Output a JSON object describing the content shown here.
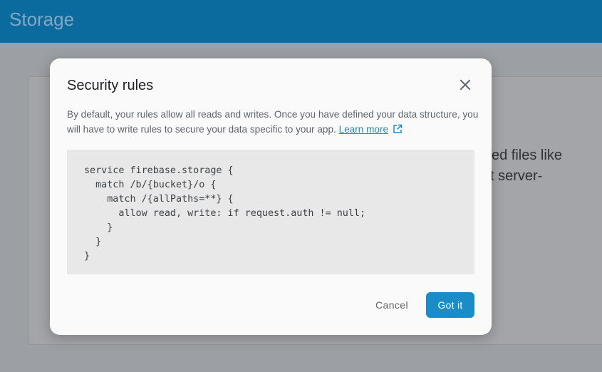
{
  "header": {
    "title": "Storage"
  },
  "background": {
    "partial_text_line1": "ed files like",
    "partial_text_line2": "t server-"
  },
  "dialog": {
    "title": "Security rules",
    "close_icon": "close-icon",
    "description": "By default, your rules allow all reads and writes. Once you have defined your data structure, you will have to write rules to secure your data specific to your app.",
    "learn_more_label": "Learn more",
    "learn_more_icon": "external-link-icon",
    "code_lines": [
      "service firebase.storage {",
      "  match /b/{bucket}/o {",
      "    match /{allPaths=**} {",
      "      allow read, write: if request.auth != null;",
      "    }",
      "  }",
      "}"
    ],
    "cancel_label": "Cancel",
    "confirm_label": "Got it"
  },
  "colors": {
    "header_bg": "#0b6a9e",
    "accent": "#1a8cc8",
    "overlay": "#9c9fa3",
    "dialog_bg": "#fafafa",
    "code_bg": "#e8e8e8"
  }
}
